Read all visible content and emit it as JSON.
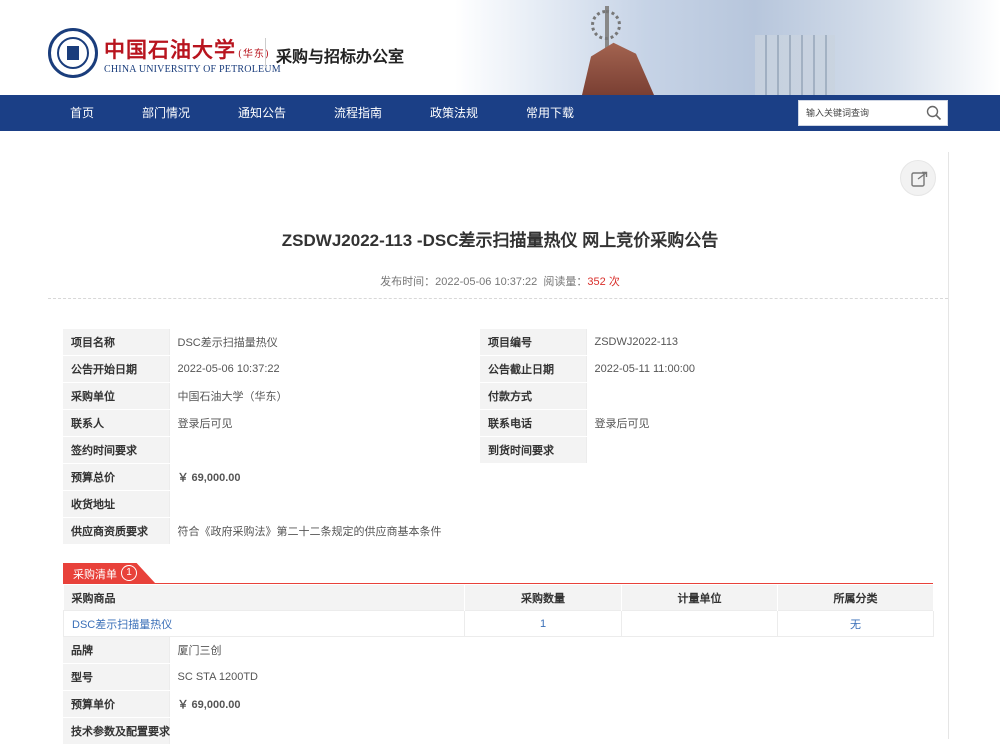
{
  "header": {
    "logo_cn": "中国石油大学",
    "logo_cn_suffix": "(华东)",
    "logo_en": "CHINA UNIVERSITY OF PETROLEUM",
    "site_title": "采购与招标办公室"
  },
  "nav": {
    "items": [
      "首页",
      "部门情况",
      "通知公告",
      "流程指南",
      "政策法规",
      "常用下载"
    ],
    "search_placeholder": "输入关键词查询"
  },
  "article": {
    "title": "ZSDWJ2022-113 -DSC差示扫描量热仪 网上竞价采购公告",
    "publish_label": "发布时间：",
    "publish_time": "2022-05-06 10:37:22",
    "views_label": "阅读量：",
    "views": "352 次"
  },
  "info": {
    "project_name_k": "项目名称",
    "project_name": "DSC差示扫描量热仪",
    "project_no_k": "项目编号",
    "project_no": "ZSDWJ2022-113",
    "start_k": "公告开始日期",
    "start": "2022-05-06 10:37:22",
    "end_k": "公告截止日期",
    "end": "2022-05-11 11:00:00",
    "buyer_k": "采购单位",
    "buyer": "中国石油大学（华东）",
    "payment_k": "付款方式",
    "payment": "",
    "contact_k": "联系人",
    "contact": "登录后可见",
    "phone_k": "联系电话",
    "phone": "登录后可见",
    "sign_time_k": "签约时间要求",
    "sign_time": "",
    "delivery_time_k": "到货时间要求",
    "delivery_time": "",
    "budget_total_k": "预算总价",
    "budget_total": "￥ 69,000.00",
    "address_k": "收货地址",
    "address": "",
    "qualification_k": "供应商资质要求",
    "qualification": "符合《政府采购法》第二十二条规定的供应商基本条件"
  },
  "procurement": {
    "tab_label": "采购清单",
    "tab_count": "1",
    "headers": [
      "采购商品",
      "采购数量",
      "计量单位",
      "所属分类"
    ],
    "rows": [
      {
        "product": "DSC差示扫描量热仪",
        "qty": "1",
        "unit": "",
        "category": "无"
      }
    ],
    "brand_k": "品牌",
    "brand": "厦门三创",
    "model_k": "型号",
    "model": "SC STA 1200TD",
    "unit_price_k": "预算单价",
    "unit_price": "￥ 69,000.00",
    "tech_k": "技术参数及配置要求"
  },
  "colors": {
    "nav_bg": "#1b3f86",
    "accent_red": "#e8413a",
    "price_red": "#d9302c",
    "link_blue": "#3a6fb8"
  }
}
